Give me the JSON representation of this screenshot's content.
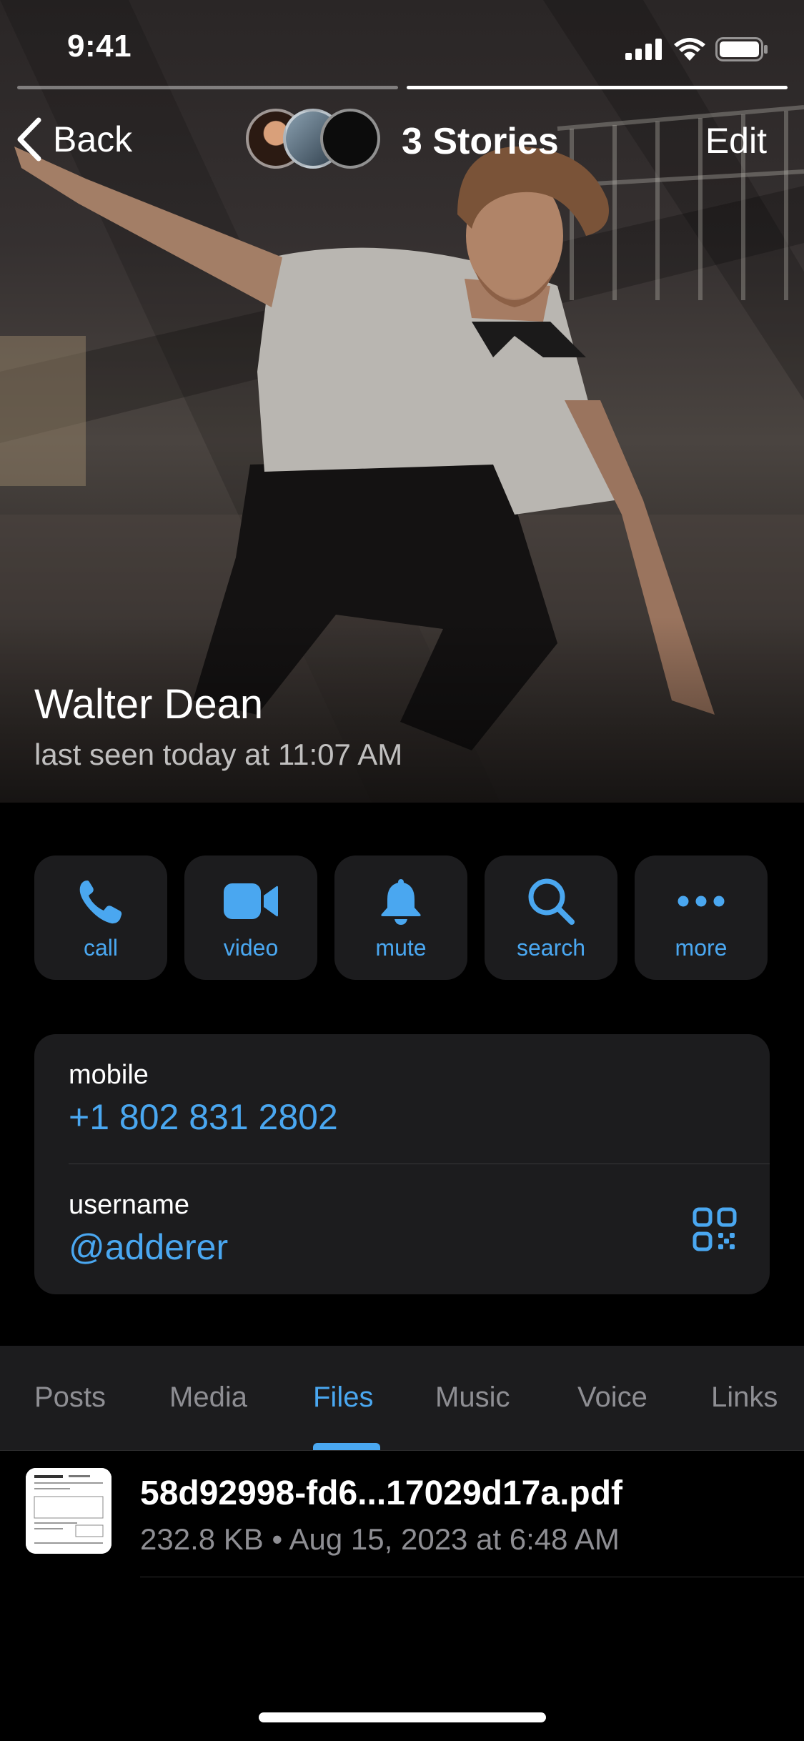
{
  "status_bar": {
    "time": "9:41"
  },
  "story": {
    "progress_segments": 2,
    "active_segment": 2
  },
  "nav": {
    "back_label": "Back",
    "stories_label": "3 Stories",
    "edit_label": "Edit"
  },
  "profile": {
    "name": "Walter Dean",
    "last_seen": "last seen today at 11:07 AM"
  },
  "actions": [
    {
      "label": "call",
      "icon": "phone-icon"
    },
    {
      "label": "video",
      "icon": "video-camera-icon"
    },
    {
      "label": "mute",
      "icon": "bell-icon"
    },
    {
      "label": "search",
      "icon": "search-icon"
    },
    {
      "label": "more",
      "icon": "more-dots-icon"
    }
  ],
  "info": {
    "mobile_label": "mobile",
    "mobile_value": "+1 802 831 2802",
    "username_label": "username",
    "username_value": "@adderer"
  },
  "tabs": [
    {
      "label": "Posts"
    },
    {
      "label": "Media"
    },
    {
      "label": "Files"
    },
    {
      "label": "Music"
    },
    {
      "label": "Voice"
    },
    {
      "label": "Links"
    }
  ],
  "active_tab": "Files",
  "files": [
    {
      "name": "58d92998-fd6...17029d17a.pdf",
      "meta": "232.8 KB • Aug 15, 2023 at 6:48 AM"
    }
  ],
  "colors": {
    "accent": "#4aa7f0",
    "card": "#1c1c1e",
    "background": "#000000"
  }
}
